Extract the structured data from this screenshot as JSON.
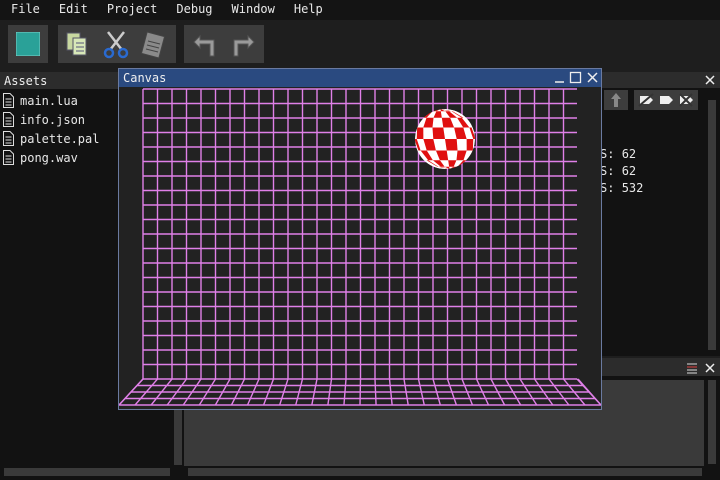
{
  "menu": [
    "File",
    "Edit",
    "Project",
    "Debug",
    "Window",
    "Help"
  ],
  "toolbar": {
    "icons": [
      "stop-icon",
      "copy-icon",
      "cut-icon",
      "paste-icon",
      "undo-icon",
      "redo-icon"
    ]
  },
  "assets": {
    "title": "Assets",
    "files": [
      "main.lua",
      "info.json",
      "palette.pal",
      "pong.wav"
    ]
  },
  "stats": [
    {
      "label": "S:",
      "value": "62"
    },
    {
      "label": "S:",
      "value": "62"
    },
    {
      "label": "S:",
      "value": "532"
    }
  ],
  "canvas": {
    "title": "Canvas",
    "grid_color": "#e080e8",
    "ball_colors": [
      "#e01010",
      "#ffffff"
    ]
  },
  "colors": {
    "accent": "#2a4a80",
    "teal": "#2aa198"
  }
}
